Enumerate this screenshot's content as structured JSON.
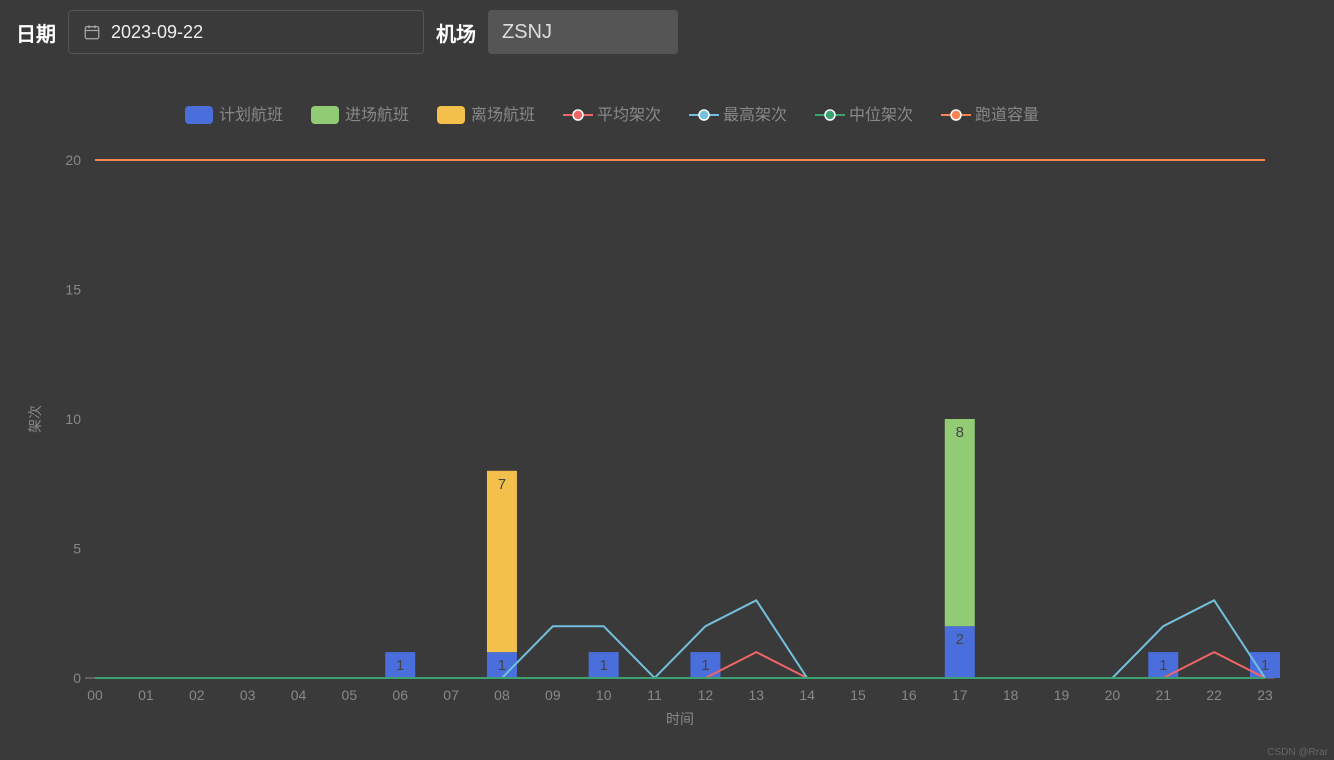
{
  "toolbar": {
    "date_label": "日期",
    "date_value": "2023-09-22",
    "airport_label": "机场",
    "airport_value": "ZSNJ"
  },
  "watermark": "CSDN @Rrar",
  "chart_data": {
    "type": "bar+line",
    "xlabel": "时间",
    "ylabel": "架次",
    "ylim": [
      0,
      20
    ],
    "yticks": [
      0,
      5,
      10,
      15,
      20
    ],
    "categories": [
      "00",
      "01",
      "02",
      "03",
      "04",
      "05",
      "06",
      "07",
      "08",
      "09",
      "10",
      "11",
      "12",
      "13",
      "14",
      "15",
      "16",
      "17",
      "18",
      "19",
      "20",
      "21",
      "22",
      "23"
    ],
    "legend": [
      {
        "name": "计划航班",
        "color": "#4a6fdc",
        "type": "bar"
      },
      {
        "name": "进场航班",
        "color": "#91cc75",
        "type": "bar"
      },
      {
        "name": "离场航班",
        "color": "#f2c04b",
        "type": "bar"
      },
      {
        "name": "平均架次",
        "color": "#ee6666",
        "type": "line"
      },
      {
        "name": "最高架次",
        "color": "#73c0de",
        "type": "line"
      },
      {
        "name": "中位架次",
        "color": "#3ba272",
        "type": "line"
      },
      {
        "name": "跑道容量",
        "color": "#fc8452",
        "type": "line"
      }
    ],
    "bars_stacked": {
      "计划航班": [
        0,
        0,
        0,
        0,
        0,
        0,
        1,
        0,
        1,
        0,
        1,
        0,
        1,
        0,
        0,
        0,
        0,
        2,
        0,
        0,
        0,
        1,
        0,
        1
      ],
      "进场航班": [
        0,
        0,
        0,
        0,
        0,
        0,
        0,
        0,
        0,
        0,
        0,
        0,
        0,
        0,
        0,
        0,
        0,
        8,
        0,
        0,
        0,
        0,
        0,
        0
      ],
      "离场航班": [
        0,
        0,
        0,
        0,
        0,
        0,
        0,
        0,
        7,
        0,
        0,
        0,
        0,
        0,
        0,
        0,
        0,
        0,
        0,
        0,
        0,
        0,
        0,
        0
      ]
    },
    "lines": {
      "平均架次": [
        0,
        0,
        0,
        0,
        0,
        0,
        0,
        0,
        0,
        0,
        0,
        0,
        0,
        1,
        0,
        0,
        0,
        0,
        0,
        0,
        0,
        0,
        1,
        0
      ],
      "最高架次": [
        0,
        0,
        0,
        0,
        0,
        0,
        0,
        0,
        0,
        2,
        2,
        0,
        2,
        3,
        0,
        0,
        0,
        0,
        0,
        0,
        0,
        2,
        3,
        0
      ],
      "中位架次": [
        0,
        0,
        0,
        0,
        0,
        0,
        0,
        0,
        0,
        0,
        0,
        0,
        0,
        0,
        0,
        0,
        0,
        0,
        0,
        0,
        0,
        0,
        0,
        0
      ],
      "跑道容量": [
        20,
        20,
        20,
        20,
        20,
        20,
        20,
        20,
        20,
        20,
        20,
        20,
        20,
        20,
        20,
        20,
        20,
        20,
        20,
        20,
        20,
        20,
        20,
        20
      ]
    }
  }
}
